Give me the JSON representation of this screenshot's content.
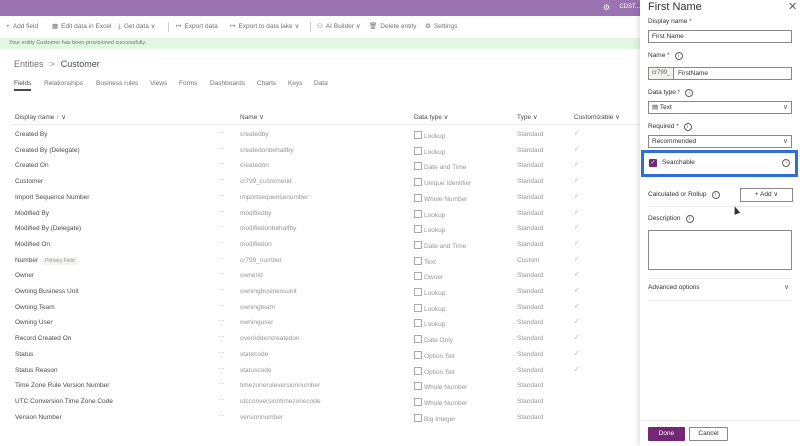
{
  "topbar": {
    "env_label": "CDST..."
  },
  "commands": [
    {
      "label": "Add field",
      "icon": "+"
    },
    {
      "label": "Edit data in Excel",
      "icon": "▦"
    },
    {
      "label": "Get data",
      "icon": "⤓"
    },
    {
      "label": "Export data",
      "icon": "↦"
    },
    {
      "label": "Export to data lake",
      "icon": "↦"
    },
    {
      "label": "AI Builder",
      "icon": "⚇"
    },
    {
      "label": "Delete entity",
      "icon": "🗑"
    },
    {
      "label": "Settings",
      "icon": "⚙"
    }
  ],
  "notification": "Your entity Customer has been provisioned successfully.",
  "breadcrumb": {
    "root": "Entities",
    "separator": ">",
    "current": "Customer"
  },
  "tabs": [
    "Fields",
    "Relationships",
    "Business rules",
    "Views",
    "Forms",
    "Dashboards",
    "Charts",
    "Keys",
    "Data"
  ],
  "table": {
    "headers": {
      "display_name": "Display name ↑ ∨",
      "name": "Name ∨",
      "data_type": "Data type ∨",
      "type": "Type ∨",
      "customizable": "Customizable ∨"
    },
    "rows": [
      {
        "display": "Created By",
        "name": "createdby",
        "dtype": "Lookup",
        "kind": "Standard",
        "check": true
      },
      {
        "display": "Created By (Delegate)",
        "name": "createdonbehalfby",
        "dtype": "Lookup",
        "kind": "Standard",
        "check": true
      },
      {
        "display": "Created On",
        "name": "createdon",
        "dtype": "Date and Time",
        "kind": "Standard",
        "check": true
      },
      {
        "display": "Customer",
        "name": "cr799_customerid",
        "dtype": "Unique Identifier",
        "kind": "Standard",
        "check": true
      },
      {
        "display": "Import Sequence Number",
        "name": "importsequencenumber",
        "dtype": "Whole Number",
        "kind": "Standard",
        "check": true
      },
      {
        "display": "Modified By",
        "name": "modifiedby",
        "dtype": "Lookup",
        "kind": "Standard",
        "check": true
      },
      {
        "display": "Modified By (Delegate)",
        "name": "modifiedonbehalfby",
        "dtype": "Lookup",
        "kind": "Standard",
        "check": true
      },
      {
        "display": "Modified On",
        "name": "modifiedon",
        "dtype": "Date and Time",
        "kind": "Standard",
        "check": true
      },
      {
        "display": "Number",
        "badge": "Primary Field",
        "name": "cr799_number",
        "dtype": "Text",
        "kind": "Custom",
        "check": true
      },
      {
        "display": "Owner",
        "name": "ownerid",
        "dtype": "Owner",
        "kind": "Standard",
        "check": true
      },
      {
        "display": "Owning Business Unit",
        "name": "owningbusinessunit",
        "dtype": "Lookup",
        "kind": "Standard",
        "check": true
      },
      {
        "display": "Owning Team",
        "name": "owningteam",
        "dtype": "Lookup",
        "kind": "Standard",
        "check": true
      },
      {
        "display": "Owning User",
        "name": "owninguser",
        "dtype": "Lookup",
        "kind": "Standard",
        "check": true
      },
      {
        "display": "Record Created On",
        "name": "overriddencreatedon",
        "dtype": "Date Only",
        "kind": "Standard",
        "check": true
      },
      {
        "display": "Status",
        "name": "statecode",
        "dtype": "Option Set",
        "kind": "Standard",
        "check": true
      },
      {
        "display": "Status Reason",
        "name": "statuscode",
        "dtype": "Option Set",
        "kind": "Standard",
        "check": true
      },
      {
        "display": "Time Zone Rule Version Number",
        "name": "timezoneruleversionnumber",
        "dtype": "Whole Number",
        "kind": "Standard",
        "check": false
      },
      {
        "display": "UTC Conversion Time Zone Code",
        "name": "utcconversiontimezonecode",
        "dtype": "Whole Number",
        "kind": "Standard",
        "check": false
      },
      {
        "display": "Version Number",
        "name": "versionnumber",
        "dtype": "Big Integer",
        "kind": "Standard",
        "check": false
      }
    ]
  },
  "panel": {
    "title": "First Name",
    "close": "✕",
    "display_name_label": "Display name",
    "display_name_value": "First Name",
    "name_label": "Name",
    "name_prefix": "cr799_",
    "name_value": "FirstName",
    "data_type_label": "Data type",
    "data_type_value": "Text",
    "required_label": "Required",
    "required_value": "Recommended",
    "searchable_label": "Searchable",
    "calculated_label": "Calculated or Rollup",
    "add_label": "+ Add ∨",
    "description_label": "Description",
    "advanced_label": "Advanced options",
    "done_label": "Done",
    "cancel_label": "Cancel",
    "required_mark": "*"
  },
  "colors": {
    "accent": "#742774",
    "topbar": "#9a73b0",
    "highlight": "#2e6ed8"
  }
}
